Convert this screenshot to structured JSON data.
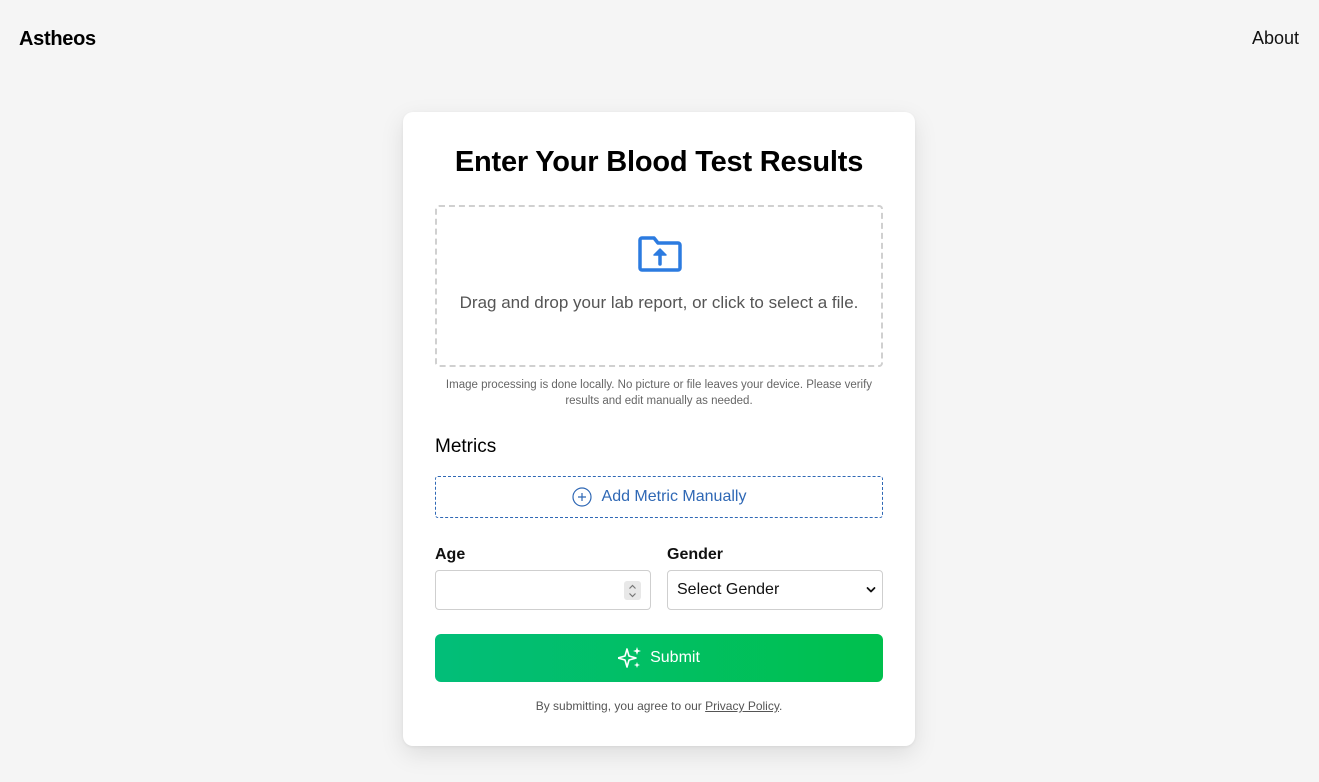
{
  "header": {
    "brand": "Astheos",
    "about_label": "About"
  },
  "form": {
    "title": "Enter Your Blood Test Results",
    "dropzone": {
      "icon": "folder-upload-icon",
      "text": "Drag and drop your lab report, or click to select a file."
    },
    "privacy_note": "Image processing is done locally. No picture or file leaves your device. Please verify results and edit manually as needed.",
    "metrics_title": "Metrics",
    "add_metric_label": "Add Metric Manually",
    "age": {
      "label": "Age",
      "value": ""
    },
    "gender": {
      "label": "Gender",
      "selected": "Select Gender"
    },
    "submit_label": "Submit",
    "legal": {
      "prefix": "By submitting, you agree to our ",
      "link": "Privacy Policy",
      "suffix": "."
    }
  },
  "colors": {
    "background": "#f5f5f5",
    "accent_blue": "#2f68b5",
    "icon_blue": "#2c7be0",
    "submit_start": "#02be79",
    "submit_end": "#00c04d"
  }
}
